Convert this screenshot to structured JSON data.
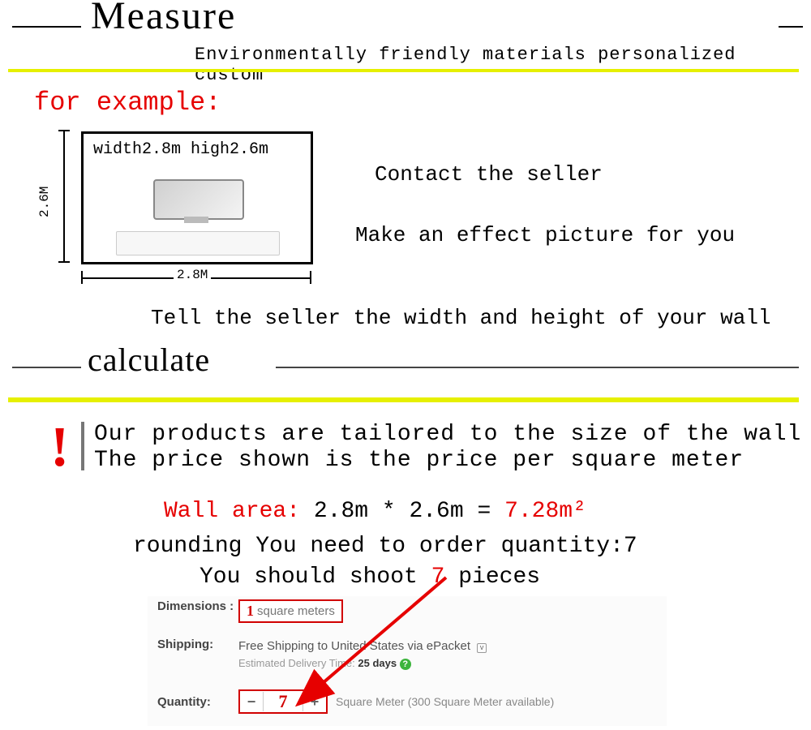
{
  "heading": "Measure",
  "subheading": "Environmentally friendly materials personalized custom",
  "for_example": "for example:",
  "wall_label": "width2.8m  high2.6m",
  "dim_v": "2.6M",
  "dim_h": "2.8M",
  "contact_1": "Contact the seller",
  "contact_2": "Make an effect picture for you",
  "tell_seller": "Tell the seller the width and height of your wall",
  "calculate_heading": "calculate",
  "note_1": "Our products are tailored to the size of the wall",
  "note_2": "The price shown is the price per square meter",
  "wall_area_label": "Wall area:",
  "wall_area_calc": " 2.8m * 2.6m = ",
  "wall_area_result": "7.28m²",
  "rounding": "rounding  You need to order quantity:7",
  "shoot_pre": "You should shoot ",
  "shoot_num": "7",
  "shoot_post": " pieces",
  "form": {
    "dim_label": "Dimensions :",
    "dim_one": "1",
    "dim_unit": "square meters",
    "ship_label": "Shipping:",
    "ship_line": "Free Shipping to United States via ePacket",
    "ship_sub_pre": "Estimated Delivery Time: ",
    "ship_sub_days": "25 days",
    "qty_label": "Quantity:",
    "qty_minus": "−",
    "qty_val": "7",
    "qty_plus": "+",
    "qty_avail": "Square Meter (300 Square Meter available)"
  }
}
